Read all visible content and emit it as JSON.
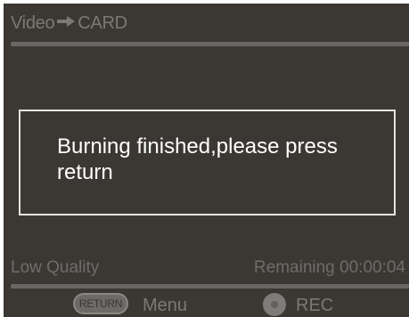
{
  "header": {
    "source": "Video",
    "direction_icon": "right-arrow-icon",
    "destination": "CARD"
  },
  "dialog": {
    "message": "Burning finished,please press return"
  },
  "status": {
    "quality": "Low Quality",
    "remaining": "Remaining 00:00:04"
  },
  "footer": {
    "return_button_label": "RETURN",
    "menu_label": "Menu",
    "rec_button_icon": "record-icon",
    "rec_label": "REC"
  },
  "colors": {
    "background": "#3b3834",
    "dimmed_text": "#7c7975",
    "message_text": "#ffffff",
    "dialog_border": "#e6e4e0"
  }
}
